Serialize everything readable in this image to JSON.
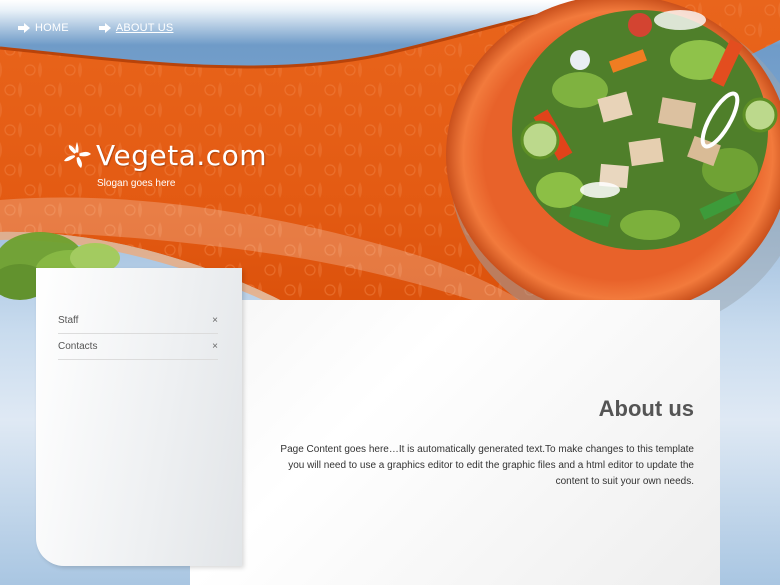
{
  "nav": {
    "items": [
      {
        "label": "HOME",
        "active": false
      },
      {
        "label": "ABOUT US",
        "active": true
      }
    ],
    "icon": "arrow-right-icon"
  },
  "header": {
    "site_title": "Vegeta.com",
    "slogan": "Slogan goes here",
    "logo_icon": "leaf-logo-icon"
  },
  "sidebar": {
    "items": [
      {
        "label": "Staff",
        "icon": "×"
      },
      {
        "label": "Contacts",
        "icon": "×"
      }
    ]
  },
  "main": {
    "heading": "About us",
    "body": "Page Content goes here…It is automatically generated text.To make changes to this template you will need to use a graphics editor to edit the graphic files and a html editor to update the content to suit your own needs."
  },
  "colors": {
    "accent": "#e8601a",
    "accent_dark": "#c94a0c",
    "background_blue": "#7aa4cf",
    "heading_text": "#555555"
  }
}
